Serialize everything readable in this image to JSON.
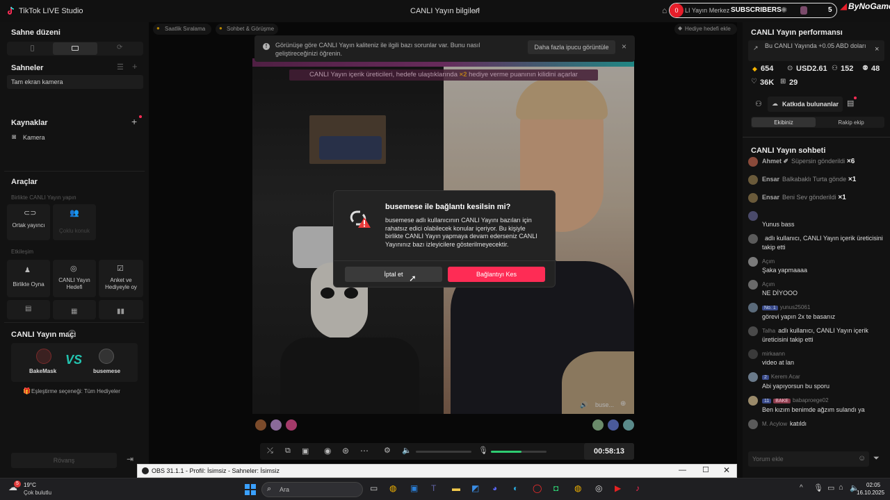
{
  "app": {
    "title": "TikTok LIVE Studio",
    "center_title": "CANLI Yayın bilgileri",
    "center_title_icon": "share-icon"
  },
  "top_right": {
    "live_center": "LI Yayın Merkez",
    "badge_count": "0",
    "subscribers_label": "SUBSCRIBERS",
    "subscribers_count": "5",
    "brand": "ByNoGame"
  },
  "left": {
    "scene_layout_title": "Sahne düzeni",
    "scenes_title": "Sahneler",
    "scene_item": "Tam ekran kamera",
    "sources_title": "Kaynaklar",
    "source_item": "Kamera",
    "tools_title": "Araçlar",
    "collab_title": "Birlikte CANLI Yayın yapın",
    "tool_cohost": "Ortak yayıncı",
    "tool_multi": "Çoklu konuk",
    "interaction_title": "Etkileşim",
    "tool_play": "Birlikte Oyna",
    "tool_goal": "CANLI Yayın Hedefi",
    "tool_poll": "Anket ve Hediyeyle oy",
    "match_title": "CANLI Yayın maçı",
    "player1": "BakeMask",
    "vs": "VS",
    "player2": "busemese",
    "match_option": "Eşleştirme seçeneği: Tüm Hediyeler",
    "rematch": "Rövanş"
  },
  "center": {
    "chip_hourly": "Saatlik Sıralama",
    "chip_chat": "Sohbet & Görüşme",
    "chip_gift": "Hediye hedefi ekle",
    "warning": "Görünüşe göre CANLI Yayın kaliteniz ile ilgili bazı sorunlar var. Bunu nasıl geliştireceğinizi öğrenin.",
    "warning_button": "Daha fazla ipucu görüntüle",
    "banner_pre": "CANLI Yayın içerik üreticileri, hedefe ulaştıklarında",
    "banner_mult": "×2",
    "banner_post": "hediye verme puanının kilidini açarlar",
    "right_video_label": "buse...",
    "timer": "00:58:13",
    "volume_level": 0.55
  },
  "dialog": {
    "title": "busemese ile bağlantı kesilsin mi?",
    "body": "busemese adlı kullanıcının CANLI Yayını bazıları için rahatsız edici olabilecek konular içeriyor. Bu kişiyle birlikte CANLI Yayın yapmaya devam ederseniz CANLI Yayınınız bazı izleyicilere gösterilmeyecektir.",
    "cancel": "İptal et",
    "confirm": "Bağlantıyı Kes"
  },
  "right": {
    "perf_title": "CANLI Yayın performansı",
    "perf_note": "Bu CANLI Yayında +0.05 ABD doları",
    "stat_diamonds": "654",
    "stat_usd": "USD2.61",
    "stat_users": "152",
    "stat_new": "48",
    "stat_likes": "36K",
    "stat_gifts": "29",
    "contributors": "Katkıda bulunanlar",
    "tab_team": "Ekibiniz",
    "tab_rival": "Rakip ekip",
    "chat_title": "CANLI Yayın sohbeti",
    "chat_placeholder": "Yorum ekle",
    "messages": [
      {
        "user": "Ahmet ✐",
        "text": "Süpersin gönderildi",
        "mult": "×6"
      },
      {
        "user": "Ensar",
        "text": "Balkabaklı Turta gönde",
        "mult": "×1"
      },
      {
        "user": "Ensar",
        "text": "Beni Sev gönderildi",
        "mult": "×1"
      },
      {
        "user": "",
        "text": "Yunus bass",
        "mult": ""
      },
      {
        "user": "",
        "text": "adlı kullanıcı, CANLI Yayın içerik üreticisini takip etti",
        "mult": ""
      },
      {
        "user": "Açım",
        "text": "Şaka yapmaaaa",
        "mult": ""
      },
      {
        "user": "Açım",
        "text": "NE DİYOOO",
        "mult": ""
      },
      {
        "user": "yunus25061",
        "text": "görevi yapın 2x te basanız",
        "mult": "",
        "badge": "No. 1"
      },
      {
        "user": "Talha",
        "text": "adlı kullanıcı, CANLI Yayın içerik üreticisini takip etti",
        "mult": ""
      },
      {
        "user": "mirkaann",
        "text": "video at lan",
        "mult": ""
      },
      {
        "user": "Kerem Acar",
        "text": "Abi yapıyorsun bu sporu",
        "mult": "",
        "badge": "2"
      },
      {
        "user": "babaproege02",
        "text": "Ben kızım benimde ağzım sulandı ya",
        "mult": "",
        "badge": "11",
        "badge2": "BAKE"
      },
      {
        "user": "M. Acylow",
        "text": "katıldı",
        "mult": ""
      }
    ]
  },
  "obs": {
    "title": "OBS 31.1.1 - Profil: İsimsiz - Sahneler: İsimsiz"
  },
  "taskbar": {
    "weather_temp": "19°C",
    "weather_desc": "Çok bulutlu",
    "weather_badge": "5",
    "search": "Ara",
    "time": "02:05",
    "date": "16.10.2025"
  }
}
